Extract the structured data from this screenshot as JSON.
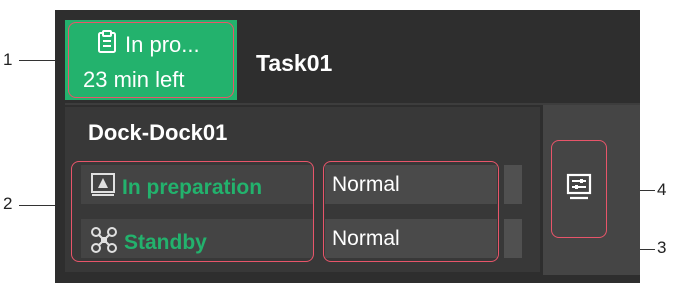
{
  "callouts": {
    "one": "1",
    "two": "2",
    "three": "3",
    "four": "4"
  },
  "task": {
    "status_text": "In pro...",
    "time_left": "23 min left",
    "name": "Task01",
    "status_icon": "clipboard-icon",
    "status_color": "#23b26d"
  },
  "dock": {
    "name": "Dock-Dock01",
    "rows": [
      {
        "icon": "dock-icon",
        "status": "In preparation",
        "value": "Normal"
      },
      {
        "icon": "drone-icon",
        "status": "Standby",
        "value": "Normal"
      }
    ]
  },
  "actions": {
    "settings_icon": "settings-list-icon"
  },
  "colors": {
    "highlight": "#e8556a",
    "card_bg": "#2e2e2e",
    "accent_green": "#23b26d"
  }
}
